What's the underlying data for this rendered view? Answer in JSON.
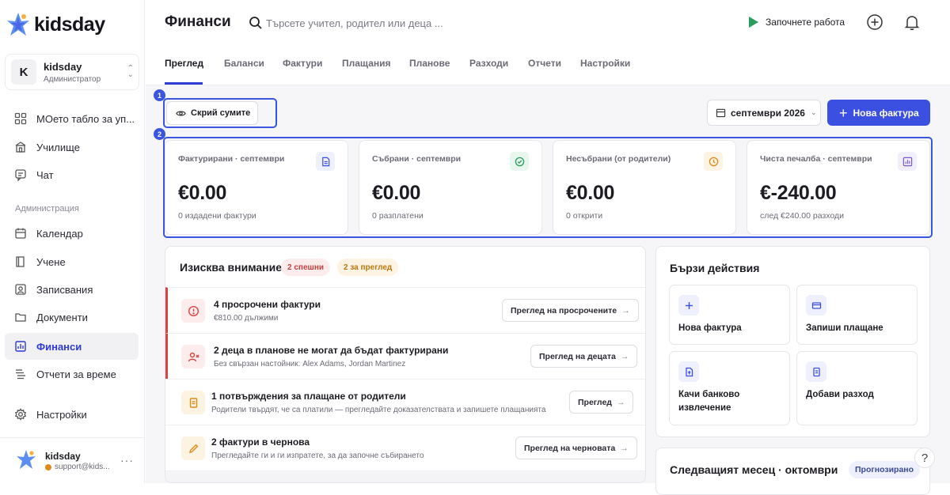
{
  "app": {
    "brand": "kidsday"
  },
  "org": {
    "badge": "K",
    "name": "kidsday",
    "role": "Администратор"
  },
  "sidebar": {
    "items": [
      {
        "label": "МОето табло за уп..."
      },
      {
        "label": "Училище"
      },
      {
        "label": "Чат"
      }
    ],
    "section_label": "Администрация",
    "admin_items": [
      {
        "label": "Календар"
      },
      {
        "label": "Учене"
      },
      {
        "label": "Записвания"
      },
      {
        "label": "Документи"
      },
      {
        "label": "Финанси"
      },
      {
        "label": "Отчети за време"
      }
    ],
    "settings_label": "Настройки"
  },
  "user": {
    "name": "kidsday",
    "email": "support@kids..."
  },
  "header": {
    "title": "Финанси",
    "search_placeholder": "Търсете учител, родител или деца ...",
    "start_label": "Започнете работа"
  },
  "tabs": [
    {
      "label": "Преглед"
    },
    {
      "label": "Баланси"
    },
    {
      "label": "Фактури"
    },
    {
      "label": "Плащания"
    },
    {
      "label": "Планове"
    },
    {
      "label": "Разходи"
    },
    {
      "label": "Отчети"
    },
    {
      "label": "Настройки"
    }
  ],
  "toolbar": {
    "hide_label": "Скрий сумите",
    "month_label": "септември 2026",
    "new_invoice_label": "Нова фактура",
    "markers": [
      "1",
      "2"
    ]
  },
  "stats": [
    {
      "label": "Фактурирани · септември",
      "value": "€0.00",
      "sub": "0 издадени фактури"
    },
    {
      "label": "Събрани · септември",
      "value": "€0.00",
      "sub": "0 разплатени"
    },
    {
      "label": "Несъбрани (от родители)",
      "value": "€0.00",
      "sub": "0 открити"
    },
    {
      "label": "Чиста печалба · септември",
      "value": "€-240.00",
      "sub": "след €240.00 разходи"
    }
  ],
  "attention": {
    "title": "Изисква внимание",
    "urgent_pill": "2 спешни",
    "review_pill": "2 за преглед",
    "rows": [
      {
        "title": "4 просрочени фактури",
        "sub": "€810.00 дължими",
        "button": "Преглед на просрочените"
      },
      {
        "title": "2 деца в планове не могат да бъдат фактурирани",
        "sub": "Без свързан настойник: Alex Adams, Jordan Martinez",
        "button": "Преглед на децата"
      },
      {
        "title": "1 потвърждения за плащане от родители",
        "sub": "Родители твърдят, че са платили — прегледайте доказателствата и запишете плащанията",
        "button": "Преглед"
      },
      {
        "title": "2 фактури в чернова",
        "sub": "Прегледайте ги и ги изпратете, за да започне събирането",
        "button": "Преглед на черновата"
      }
    ]
  },
  "quick_actions": {
    "title": "Бързи действия",
    "items": [
      {
        "label": "Нова фактура"
      },
      {
        "label": "Запиши плащане"
      },
      {
        "label": "Качи банково извлечение"
      },
      {
        "label": "Добави разход"
      }
    ]
  },
  "next_month": {
    "title": "Следващият месец · октомври",
    "pill": "Прогнозирано"
  },
  "help": {
    "label": "?"
  },
  "colors": {
    "accent": "#3b4fe0",
    "urgent": "#d64545",
    "warning": "#e08a1a",
    "success": "#2a9d5c"
  }
}
